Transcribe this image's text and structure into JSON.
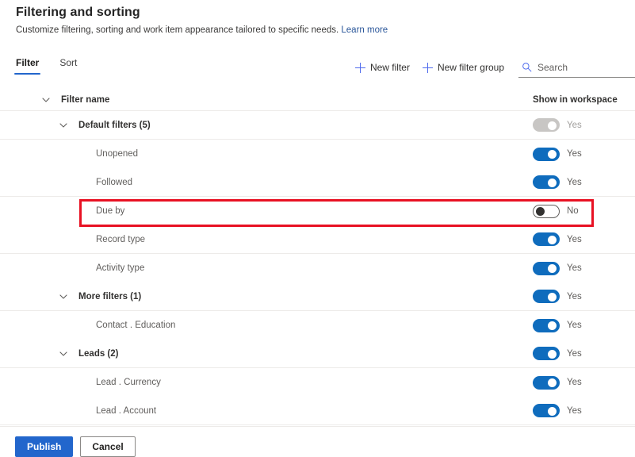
{
  "header": {
    "title": "Filtering and sorting",
    "subtitle": "Customize filtering, sorting and work item appearance tailored to specific needs.",
    "learn_more": "Learn more"
  },
  "tabs": [
    {
      "label": "Filter",
      "active": true
    },
    {
      "label": "Sort",
      "active": false
    }
  ],
  "commands": {
    "new_filter": "New filter",
    "new_filter_group": "New filter group",
    "search_placeholder": "Search",
    "search_value": ""
  },
  "table": {
    "columns": {
      "name": "Filter name",
      "toggle": "Show in workspace"
    },
    "rows": [
      {
        "label": "Default filters (5)",
        "level": 1,
        "group": true,
        "expanded": true,
        "toggle_state": "disabled",
        "toggle_label": "Yes",
        "divider": true
      },
      {
        "label": "Unopened",
        "level": 2,
        "group": false,
        "expanded": null,
        "toggle_state": "on",
        "toggle_label": "Yes",
        "divider": false
      },
      {
        "label": "Followed",
        "level": 2,
        "group": false,
        "expanded": null,
        "toggle_state": "on",
        "toggle_label": "Yes",
        "divider": true
      },
      {
        "label": "Due by",
        "level": 2,
        "group": false,
        "expanded": null,
        "toggle_state": "off",
        "toggle_label": "No",
        "divider": false,
        "highlighted": true
      },
      {
        "label": "Record type",
        "level": 2,
        "group": false,
        "expanded": null,
        "toggle_state": "on",
        "toggle_label": "Yes",
        "divider": true
      },
      {
        "label": "Activity type",
        "level": 2,
        "group": false,
        "expanded": null,
        "toggle_state": "on",
        "toggle_label": "Yes",
        "divider": false
      },
      {
        "label": "More filters (1)",
        "level": 1,
        "group": true,
        "expanded": true,
        "toggle_state": "on",
        "toggle_label": "Yes",
        "divider": true
      },
      {
        "label": "Contact . Education",
        "level": 2,
        "group": false,
        "expanded": null,
        "toggle_state": "on",
        "toggle_label": "Yes",
        "divider": false
      },
      {
        "label": "Leads (2)",
        "level": 1,
        "group": true,
        "expanded": true,
        "toggle_state": "on",
        "toggle_label": "Yes",
        "divider": true
      },
      {
        "label": "Lead . Currency",
        "level": 2,
        "group": false,
        "expanded": null,
        "toggle_state": "on",
        "toggle_label": "Yes",
        "divider": false
      },
      {
        "label": "Lead . Account",
        "level": 2,
        "group": false,
        "expanded": null,
        "toggle_state": "on",
        "toggle_label": "Yes",
        "divider": true
      }
    ]
  },
  "footer": {
    "publish": "Publish",
    "cancel": "Cancel"
  },
  "colors": {
    "accent": "#2266cc",
    "toggle_on": "#0f6cbd",
    "toggle_disabled": "#c8c6c4",
    "highlight": "#e81123",
    "link": "#2b579a",
    "plus": "#4f6bed"
  }
}
